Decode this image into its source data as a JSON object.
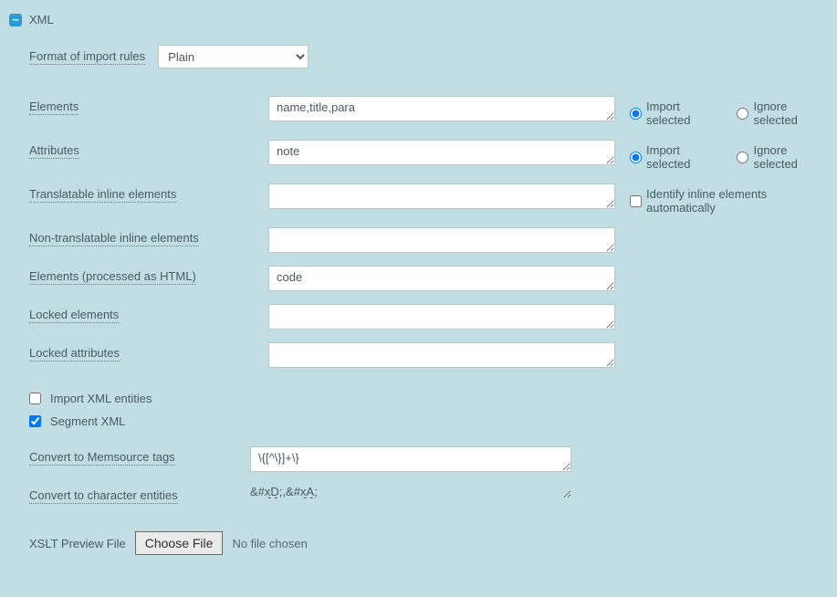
{
  "header": {
    "title": "XML"
  },
  "format": {
    "label": "Format of import rules",
    "selected": "Plain"
  },
  "fields": {
    "elements": {
      "label": "Elements",
      "value": "name,title,para",
      "radios": {
        "import": "Import selected",
        "ignore": "Ignore selected",
        "selected": "import"
      }
    },
    "attributes": {
      "label": "Attributes",
      "value": "note",
      "radios": {
        "import": "Import selected",
        "ignore": "Ignore selected",
        "selected": "import"
      }
    },
    "transInline": {
      "label": "Translatable inline elements",
      "value": "",
      "check": {
        "label": "Identify inline elements automatically",
        "checked": false
      }
    },
    "nonTransInline": {
      "label": "Non-translatable inline elements",
      "value": ""
    },
    "htmlElements": {
      "label": "Elements (processed as HTML)",
      "value": "code"
    },
    "lockedElements": {
      "label": "Locked elements",
      "value": ""
    },
    "lockedAttributes": {
      "label": "Locked attributes",
      "value": ""
    }
  },
  "checks": {
    "importEntities": {
      "label": "Import XML entities",
      "checked": false
    },
    "segmentXml": {
      "label": "Segment XML",
      "checked": true
    }
  },
  "convert": {
    "tags": {
      "label": "Convert to Memsource tags",
      "value": "\\{[^\\}]+\\}"
    },
    "entities": {
      "label": "Convert to character entities",
      "value_a": "&#",
      "value_b": "xD",
      "value_c": ";,&#",
      "value_d": "xA",
      "value_e": ";"
    }
  },
  "xslt": {
    "label": "XSLT Preview File",
    "button": "Choose File",
    "status": "No file chosen"
  }
}
